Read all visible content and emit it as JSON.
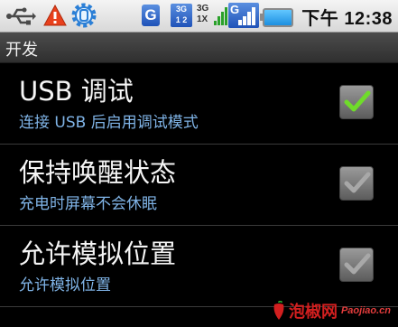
{
  "statusbar": {
    "icons": [
      "usb-icon",
      "warning-icon",
      "debug-gear-icon",
      "g-icon",
      "3g-icon",
      "signal-icon",
      "g-signal-icon",
      "battery-icon"
    ],
    "badge_g": "G",
    "badge_3g_top": "3G",
    "badge_3g_bottom": "1 2",
    "net_line1": "3G",
    "net_line2": "1X",
    "g_signal_label": "G",
    "time": "下午 12:38"
  },
  "titlebar": {
    "title": "开发"
  },
  "settings": [
    {
      "title": "USB 调试",
      "summary": "连接 USB 后启用调试模式",
      "checked": true,
      "check_color": "#6fdc2a"
    },
    {
      "title": "保持唤醒状态",
      "summary": "充电时屏幕不会休眠",
      "checked": true,
      "check_color": "#a8a8a8"
    },
    {
      "title": "允许模拟位置",
      "summary": "允许模拟位置",
      "checked": true,
      "check_color": "#a8a8a8"
    }
  ],
  "watermark": {
    "text": "泡椒网",
    "site": "Paojiao.cn"
  },
  "colors": {
    "summary_text": "#7fb3e6",
    "watermark": "#d21f1f"
  }
}
